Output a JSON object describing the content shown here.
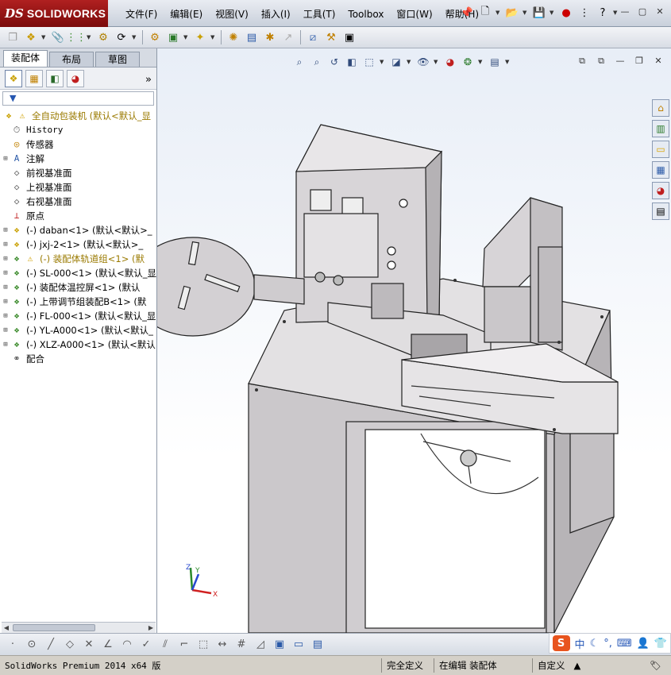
{
  "app": {
    "logo_ds": "DS",
    "logo_text": "SOLIDWORKS"
  },
  "menu": [
    "文件(F)",
    "编辑(E)",
    "视图(V)",
    "插入(I)",
    "工具(T)",
    "Toolbox",
    "窗口(W)",
    "帮助(H)"
  ],
  "command_manager": {
    "tabs": [
      "装配体",
      "布局",
      "草图"
    ],
    "active_tab": "装配体"
  },
  "feature_tree": {
    "root": "全自动包装机  (默认<默认_显",
    "items": [
      {
        "icon": "history-icon",
        "label": "History",
        "mono": true
      },
      {
        "icon": "sensor-icon",
        "label": "传感器"
      },
      {
        "icon": "annotation-icon",
        "label": "注解",
        "expandable": true
      },
      {
        "icon": "plane-icon",
        "label": "前视基准面"
      },
      {
        "icon": "plane-icon",
        "label": "上视基准面"
      },
      {
        "icon": "plane-icon",
        "label": "右视基准面"
      },
      {
        "icon": "origin-icon",
        "label": "原点"
      },
      {
        "icon": "part-icon",
        "label": "(-) daban<1> (默认<默认>_",
        "expandable": true
      },
      {
        "icon": "part-icon",
        "label": "(-) jxj-2<1> (默认<默认>_",
        "expandable": true
      },
      {
        "icon": "assembly-warning-icon",
        "label": "(-) 装配体轨道组<1> (默",
        "expandable": true,
        "warn": true
      },
      {
        "icon": "assembly-icon",
        "label": "(-) SL-000<1> (默认<默认_显",
        "expandable": true
      },
      {
        "icon": "assembly-icon",
        "label": "(-) 装配体温控屏<1> (默认",
        "expandable": true
      },
      {
        "icon": "assembly-icon",
        "label": "(-) 上带调节组装配B<1> (默",
        "expandable": true
      },
      {
        "icon": "assembly-icon",
        "label": "(-) FL-000<1> (默认<默认_显",
        "expandable": true
      },
      {
        "icon": "assembly-icon",
        "label": "(-) YL-A000<1> (默认<默认_",
        "expandable": true
      },
      {
        "icon": "assembly-icon",
        "label": "(-) XLZ-A000<1> (默认<默认",
        "expandable": true
      },
      {
        "icon": "mates-icon",
        "label": "配合"
      }
    ]
  },
  "triad": {
    "x": "X",
    "y": "Y",
    "z": "Z"
  },
  "ime": {
    "lang": "中"
  },
  "status": {
    "product": "SolidWorks Premium 2014 x64 版",
    "definition": "完全定义",
    "mode": "在编辑 装配体",
    "units": "自定义"
  }
}
